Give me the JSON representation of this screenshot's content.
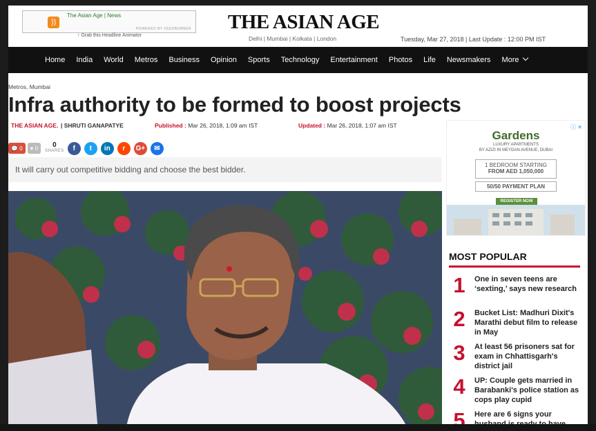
{
  "header": {
    "feed_title": "The Asian Age | News",
    "feed_powered": "POWERED BY FEEDBURNER",
    "grab_link": "↑ Grab this Headline Animator",
    "logo": "THE ASIAN AGE",
    "cities": "Delhi | Mumbai | Kolkata | London",
    "dateline": "Tuesday, Mar 27, 2018 | Last Update : 12:00 PM IST"
  },
  "nav": {
    "items": [
      "Home",
      "India",
      "World",
      "Metros",
      "Business",
      "Opinion",
      "Sports",
      "Technology",
      "Entertainment",
      "Photos",
      "Life",
      "Newsmakers",
      "More"
    ]
  },
  "article": {
    "breadcrumb": "Metros, Mumbai",
    "headline": "Infra authority to be formed to boost projects",
    "source": "THE ASIAN AGE.",
    "author": "| SHRUTI GANAPATYE",
    "published_label": "Published :",
    "published": "Mar 26, 2018, 1:09 am IST",
    "updated_label": "Updated :",
    "updated": "Mar 26, 2018, 1:07 am IST",
    "comments_count": "0",
    "likes_count": "0",
    "shares_count": "0",
    "shares_label": "SHARES",
    "summary": "It will carry out competitive bidding and choose the best bidder."
  },
  "ad": {
    "logo": "Gardens",
    "sub": "LUXURY APARTMENTS",
    "sub2": "BY AZIZI IN MEYDAN AVENUE, DUBAI",
    "offer_line1": "1 BEDROOM STARTING",
    "offer_line2": "FROM AED 1,050,000",
    "payment": "50/50 PAYMENT PLAN",
    "register": "REGISTER NOW"
  },
  "most_popular": {
    "title": "MOST POPULAR",
    "items": [
      {
        "num": "1",
        "text": "One in seven teens are ‘sexting,’ says new research"
      },
      {
        "num": "2",
        "text": "Bucket List: Madhuri Dixit's Marathi debut film to release in May"
      },
      {
        "num": "3",
        "text": "At least 56 prisoners sat for exam in Chhattisgarh's district jail"
      },
      {
        "num": "4",
        "text": "UP: Couple gets married in Barabanki's police station as cops play cupid"
      },
      {
        "num": "5",
        "text": "Here are 6 signs your husband is ready to have"
      }
    ]
  },
  "colors": {
    "brand_red": "#c8102e",
    "nav_bg": "#111111"
  }
}
